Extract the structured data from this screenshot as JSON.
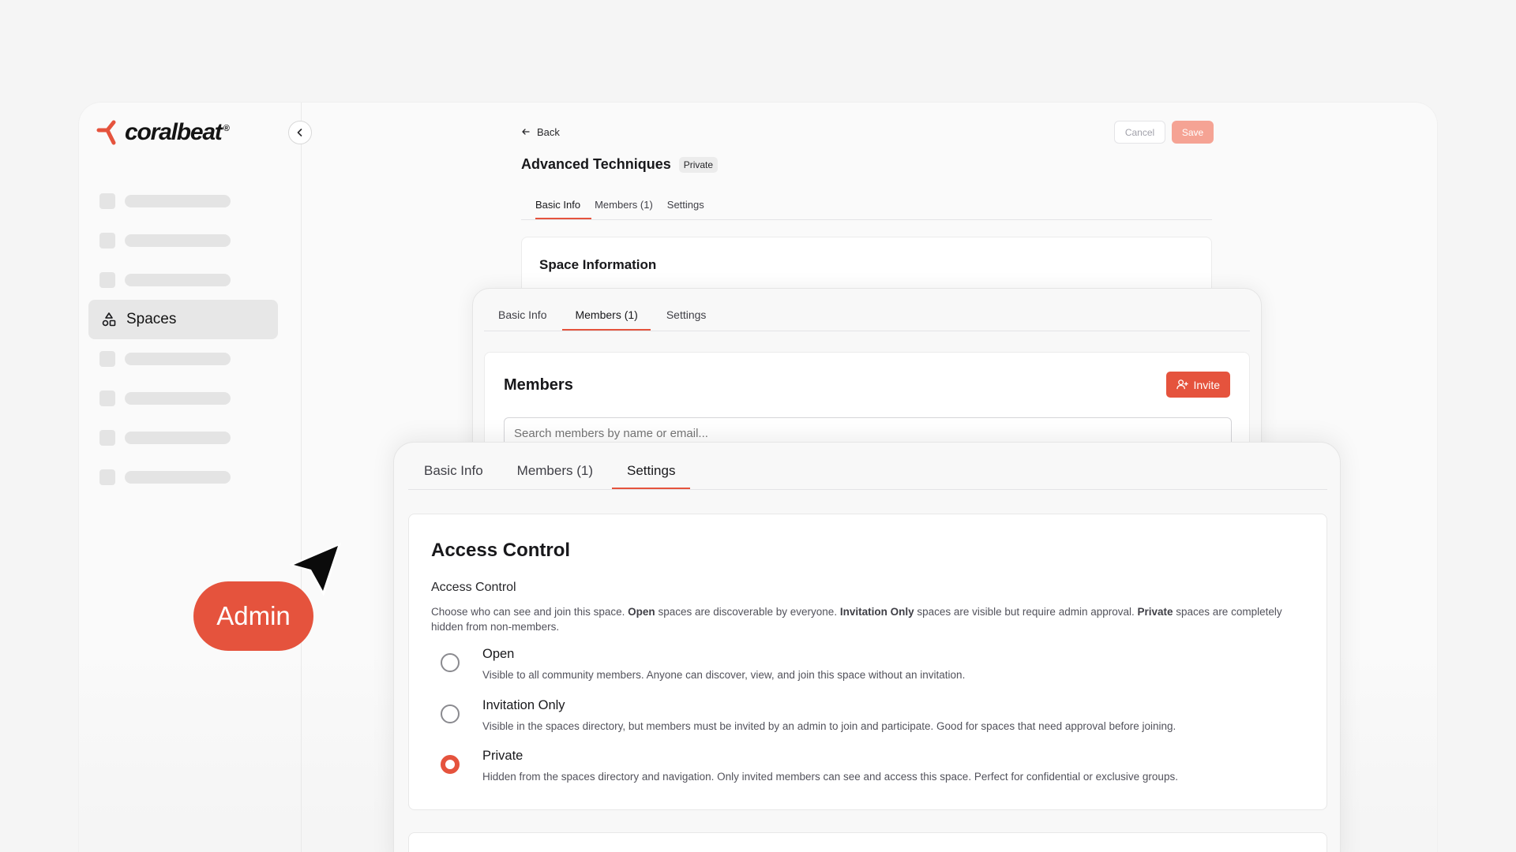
{
  "brand": {
    "name": "coralbeat",
    "reg": "®",
    "accent": "#e5533d"
  },
  "sidebar": {
    "collapse_icon": "chevron-left-icon",
    "active_item": {
      "label": "Spaces",
      "icon": "shapes-icon"
    }
  },
  "page": {
    "back_label": "Back",
    "cancel_label": "Cancel",
    "save_label": "Save",
    "title": "Advanced Techniques",
    "badge": "Private",
    "tabs": [
      "Basic Info",
      "Members (1)",
      "Settings"
    ],
    "section_title": "Space Information"
  },
  "members_panel": {
    "tabs": [
      "Basic Info",
      "Members (1)",
      "Settings"
    ],
    "title": "Members",
    "invite_label": "Invite",
    "search_placeholder": "Search members by name or email..."
  },
  "settings_panel": {
    "tabs": [
      "Basic Info",
      "Members (1)",
      "Settings"
    ],
    "title": "Access Control",
    "field_label": "Access Control",
    "description": {
      "p1": "Choose who can see and join this space. ",
      "b1": "Open",
      "p2": " spaces are discoverable by everyone. ",
      "b2": "Invitation Only",
      "p3": " spaces are visible but require admin approval. ",
      "b3": "Private",
      "p4": " spaces are completely hidden from non-members."
    },
    "options": [
      {
        "title": "Open",
        "description": "Visible to all community members. Anyone can discover, view, and join this space without an invitation.",
        "checked": false
      },
      {
        "title": "Invitation Only",
        "description": "Visible in the spaces directory, but members must be invited by an admin to join and participate. Good for spaces that need approval before joining.",
        "checked": false
      },
      {
        "title": "Private",
        "description": "Hidden from the spaces directory and navigation. Only invited members can see and access this space. Perfect for confidential or exclusive groups.",
        "checked": true
      }
    ]
  },
  "callout": {
    "label": "Admin"
  }
}
